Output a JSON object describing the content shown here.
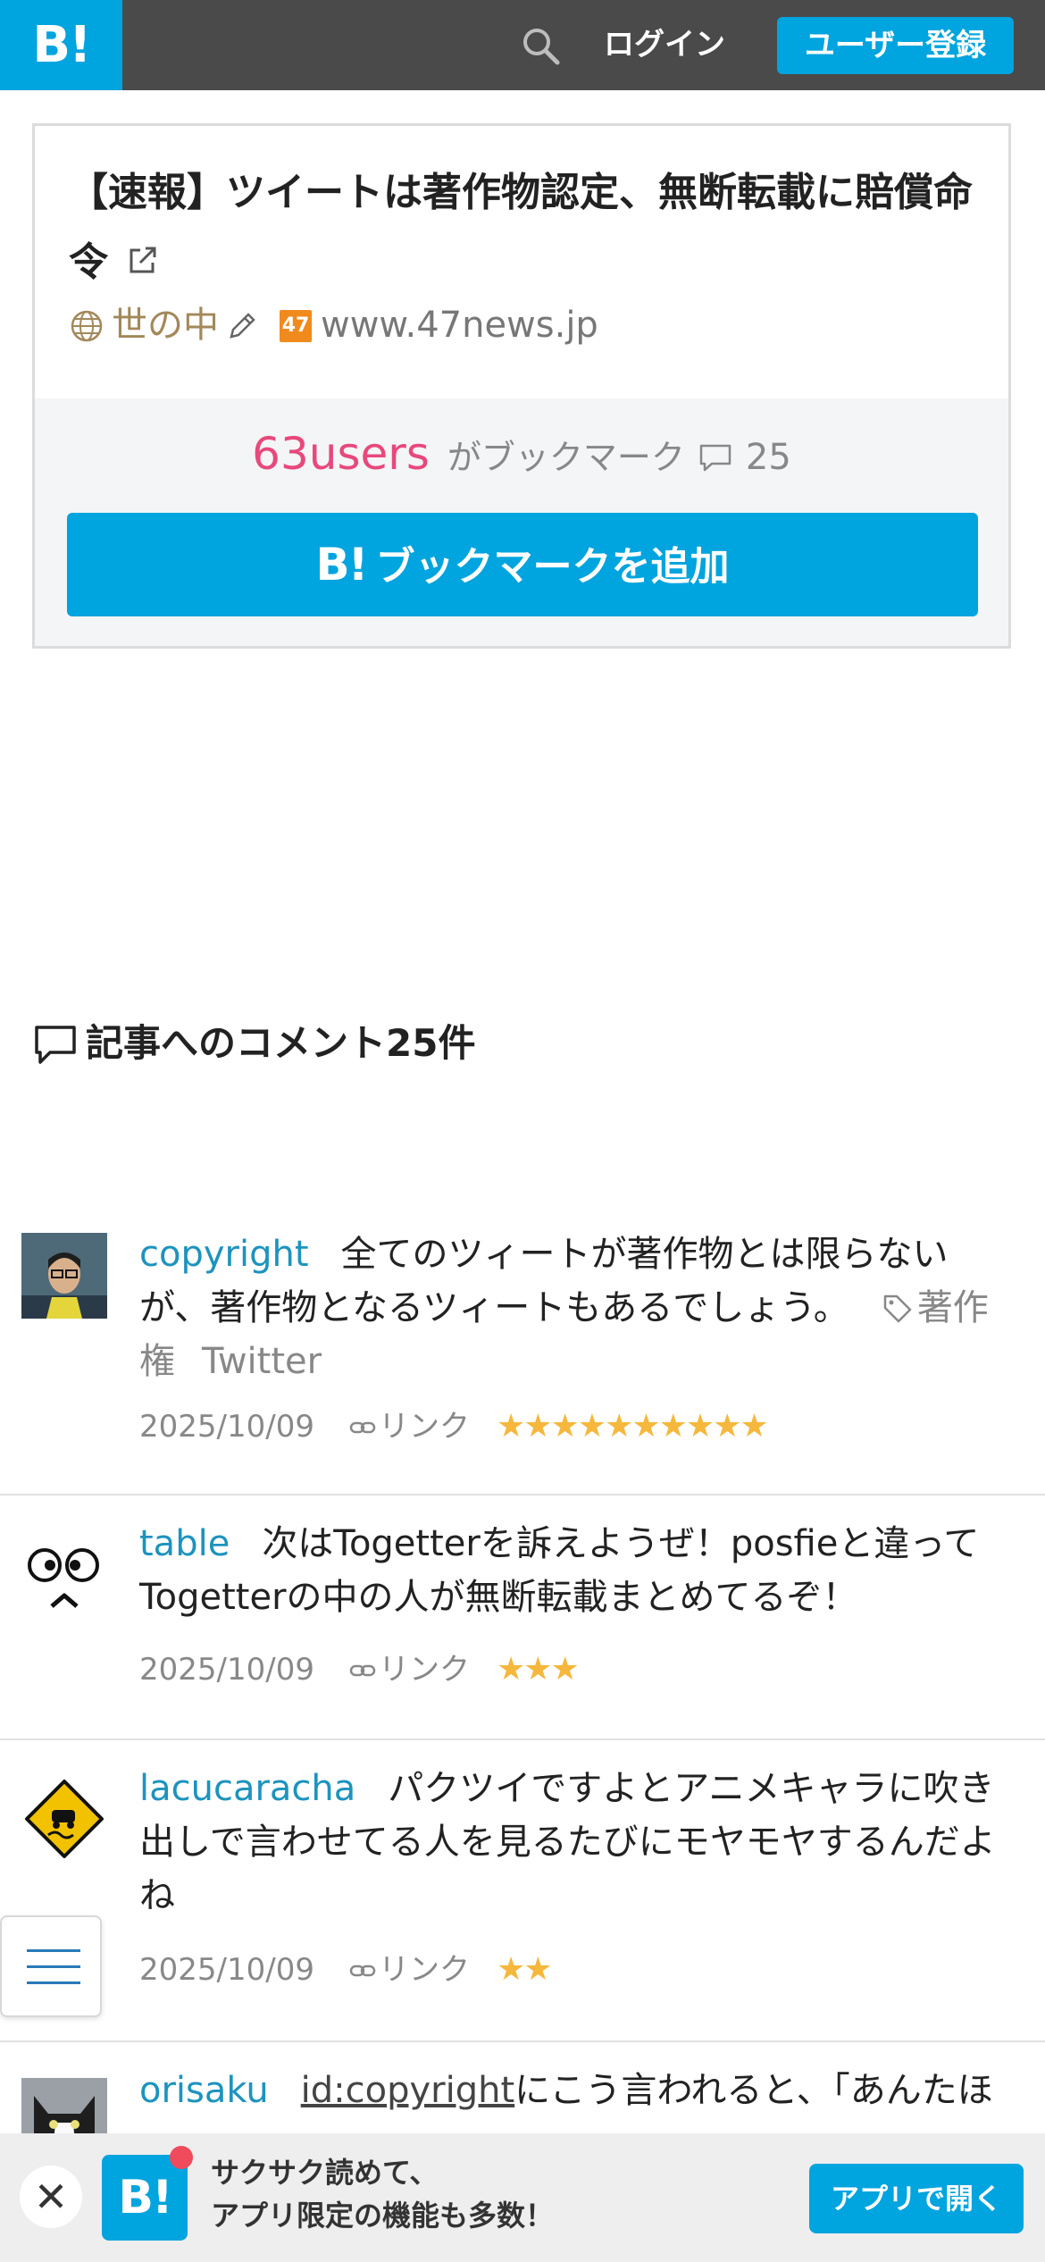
{
  "header": {
    "logo": "B!",
    "login_label": "ログイン",
    "signup_label": "ユーザー登録"
  },
  "entry": {
    "title": "【速報】ツイートは著作物認定、無断転載に賠償命令",
    "category": "世の中",
    "favicon_text": "47",
    "domain": "www.47news.jp",
    "users": "63users",
    "bookmark_text": "がブックマーク",
    "comment_count": "25",
    "add_bookmark_logo": "B!",
    "add_bookmark_label": "ブックマークを追加"
  },
  "comments_section": {
    "heading": "記事へのコメント25件"
  },
  "comments": [
    {
      "user": "copyright",
      "text": "全てのツィートが著作物とは限らないが、著作物となるツィートもあるでしょう。",
      "tags": [
        "著作権",
        "Twitter"
      ],
      "date": "2025/10/09",
      "link_label": "リンク",
      "stars": "★★★★★★★★★★"
    },
    {
      "user": "table",
      "text": "次はTogetterを訴えようぜ！posfieと違ってTogetterの中の人が無断転載まとめてるぞ！",
      "date": "2025/10/09",
      "link_label": "リンク",
      "stars": "★★★"
    },
    {
      "user": "lacucaracha",
      "text": "パクツイですよとアニメキャラに吹き出しで言わせてる人を見るたびにモヤモヤするんだよね",
      "date": "2025/10/09",
      "link_label": "リンク",
      "stars": "★★"
    },
    {
      "user": "orisaku",
      "id_link": "id:copyright",
      "text": "にこう言われると、「あんたほ"
    }
  ],
  "app_banner": {
    "close": "✕",
    "logo": "B!",
    "line1": "サクサク読めて、",
    "line2": "アプリ限定の機能も多数！",
    "open_label": "アプリで開く"
  }
}
